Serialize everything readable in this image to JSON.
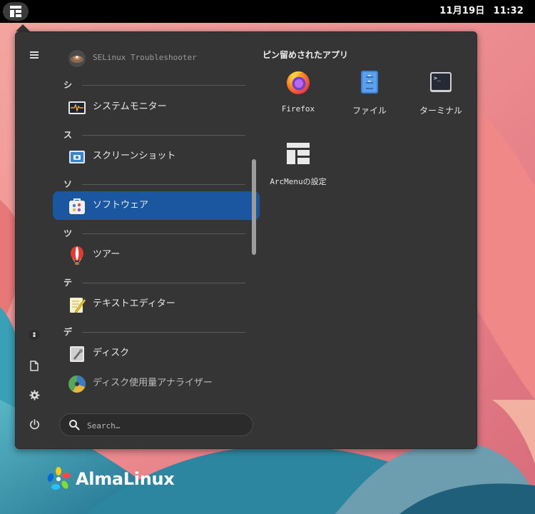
{
  "topbar": {
    "date": "11月19日",
    "time": "11:32"
  },
  "menu": {
    "app_list": [
      {
        "type": "app",
        "label": "SELinux Troubleshooter",
        "icon": "selinux-icon"
      },
      {
        "type": "section",
        "letter": "シ"
      },
      {
        "type": "app",
        "label": "システムモニター",
        "icon": "system-monitor-icon"
      },
      {
        "type": "section",
        "letter": "ス"
      },
      {
        "type": "app",
        "label": "スクリーンショット",
        "icon": "screenshot-icon"
      },
      {
        "type": "section",
        "letter": "ソ"
      },
      {
        "type": "app",
        "label": "ソフトウェア",
        "icon": "software-icon",
        "selected": true
      },
      {
        "type": "section",
        "letter": "ツ"
      },
      {
        "type": "app",
        "label": "ツアー",
        "icon": "tour-balloon-icon"
      },
      {
        "type": "section",
        "letter": "テ"
      },
      {
        "type": "app",
        "label": "テキストエディター",
        "icon": "text-editor-icon"
      },
      {
        "type": "section",
        "letter": "デ"
      },
      {
        "type": "app",
        "label": "ディスク",
        "icon": "disks-icon"
      },
      {
        "type": "app",
        "label": "ディスク使用量アナライザー",
        "icon": "disk-usage-icon"
      }
    ],
    "search": {
      "placeholder": "Search…"
    },
    "pinned": {
      "title": "ピン留めされたアプリ",
      "apps": [
        {
          "label": "Firefox",
          "icon": "firefox-icon"
        },
        {
          "label": "ファイル",
          "icon": "files-icon"
        },
        {
          "label": "ターミナル",
          "icon": "terminal-icon"
        },
        {
          "label": "ArcMenuの設定",
          "icon": "arcmenu-settings-icon"
        }
      ]
    },
    "rail": [
      "hamburger-icon",
      "user-icon",
      "documents-icon",
      "settings-gear-icon",
      "power-icon"
    ]
  },
  "branding": {
    "logo_text": "AlmaLinux"
  },
  "colors": {
    "topbar": "#000000",
    "menu_bg": "#353535",
    "selection": "#1b56a0"
  }
}
